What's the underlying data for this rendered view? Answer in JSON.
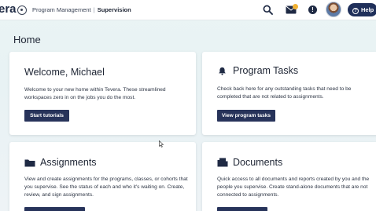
{
  "header": {
    "logo_text": "era",
    "breadcrumb": {
      "parent": "Program Management",
      "separator": "|",
      "current": "Supervision"
    },
    "icons": [
      "back-icon",
      "search-icon",
      "mail-icon",
      "alert-icon"
    ],
    "help_label": "Help",
    "colors": {
      "accent": "#1f2f5a",
      "notification": "#f2b233"
    }
  },
  "page": {
    "title": "Home"
  },
  "cards": {
    "welcome": {
      "title": "Welcome, Michael",
      "body": "Welcome to your new home within Tevera. These streamlined workspaces zero in on the jobs you do the most.",
      "button": "Start tutorials"
    },
    "tasks": {
      "title": "Program Tasks",
      "icon": "bell-icon",
      "body": "Check back here for any outstanding tasks that need to be completed that are not related to assignments.",
      "button": "View program tasks"
    },
    "assignments": {
      "title": "Assignments",
      "icon": "folder-icon",
      "body": "View and create assignments for the programs, classes, or cohorts that you supervise. See the status of each and who it's waiting on. Create, review, and sign assignments."
    },
    "documents": {
      "title": "Documents",
      "icon": "document-folder-icon",
      "body": "Quick access to all documents and reports created by you and the people you supervise. Create stand-alone documents that are not connected to assignments."
    }
  }
}
